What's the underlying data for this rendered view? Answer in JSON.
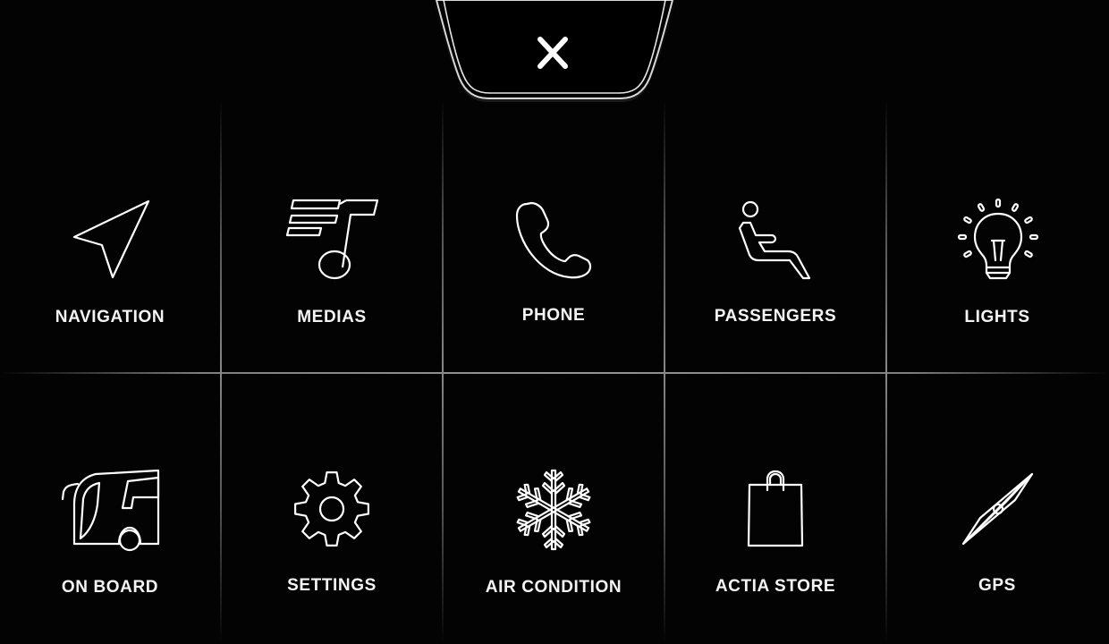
{
  "close": {
    "icon": "close-icon"
  },
  "tiles": [
    {
      "label": "NAVIGATION",
      "icon": "navigation-arrow-icon"
    },
    {
      "label": "MEDIAS",
      "icon": "music-note-icon"
    },
    {
      "label": "PHONE",
      "icon": "phone-icon"
    },
    {
      "label": "PASSENGERS",
      "icon": "seated-passenger-icon"
    },
    {
      "label": "LIGHTS",
      "icon": "light-bulb-icon"
    },
    {
      "label": "ON BOARD",
      "icon": "bus-icon"
    },
    {
      "label": "SETTINGS",
      "icon": "gear-icon"
    },
    {
      "label": "AIR CONDITION",
      "icon": "snowflake-icon"
    },
    {
      "label": "ACTIA STORE",
      "icon": "shopping-bag-icon"
    },
    {
      "label": "GPS",
      "icon": "compass-icon"
    }
  ],
  "colors": {
    "background": "#030303",
    "foreground": "#ffffff",
    "divider": "#8a8a8a"
  }
}
